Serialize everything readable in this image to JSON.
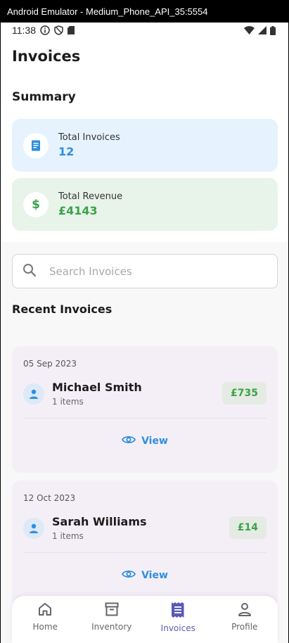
{
  "window": {
    "title": "Android Emulator - Medium_Phone_API_35:5554"
  },
  "status_bar": {
    "time": "11:38"
  },
  "page": {
    "title": "Invoices",
    "summary_title": "Summary"
  },
  "summary": {
    "total_invoices": {
      "label": "Total Invoices",
      "value": "12",
      "icon": "receipt-icon",
      "color": "#2e8fe0"
    },
    "total_revenue": {
      "label": "Total Revenue",
      "value": "£4143",
      "icon": "dollar-icon",
      "color": "#3aa24a"
    }
  },
  "search": {
    "placeholder": "Search Invoices",
    "value": ""
  },
  "recent": {
    "title": "Recent Invoices",
    "invoices": [
      {
        "date": "05 Sep 2023",
        "customer": "Michael Smith",
        "items": "1 items",
        "amount": "£735",
        "view_label": "View"
      },
      {
        "date": "12 Oct 2023",
        "customer": "Sarah Williams",
        "items": "1 items",
        "amount": "£14",
        "view_label": "View"
      }
    ]
  },
  "nav": {
    "items": [
      {
        "label": "Home",
        "icon": "home-icon",
        "active": false
      },
      {
        "label": "Inventory",
        "icon": "inventory-icon",
        "active": false
      },
      {
        "label": "Invoices",
        "icon": "invoices-icon",
        "active": true
      },
      {
        "label": "Profile",
        "icon": "profile-icon",
        "active": false
      }
    ],
    "active_color": "#5b58b5"
  }
}
